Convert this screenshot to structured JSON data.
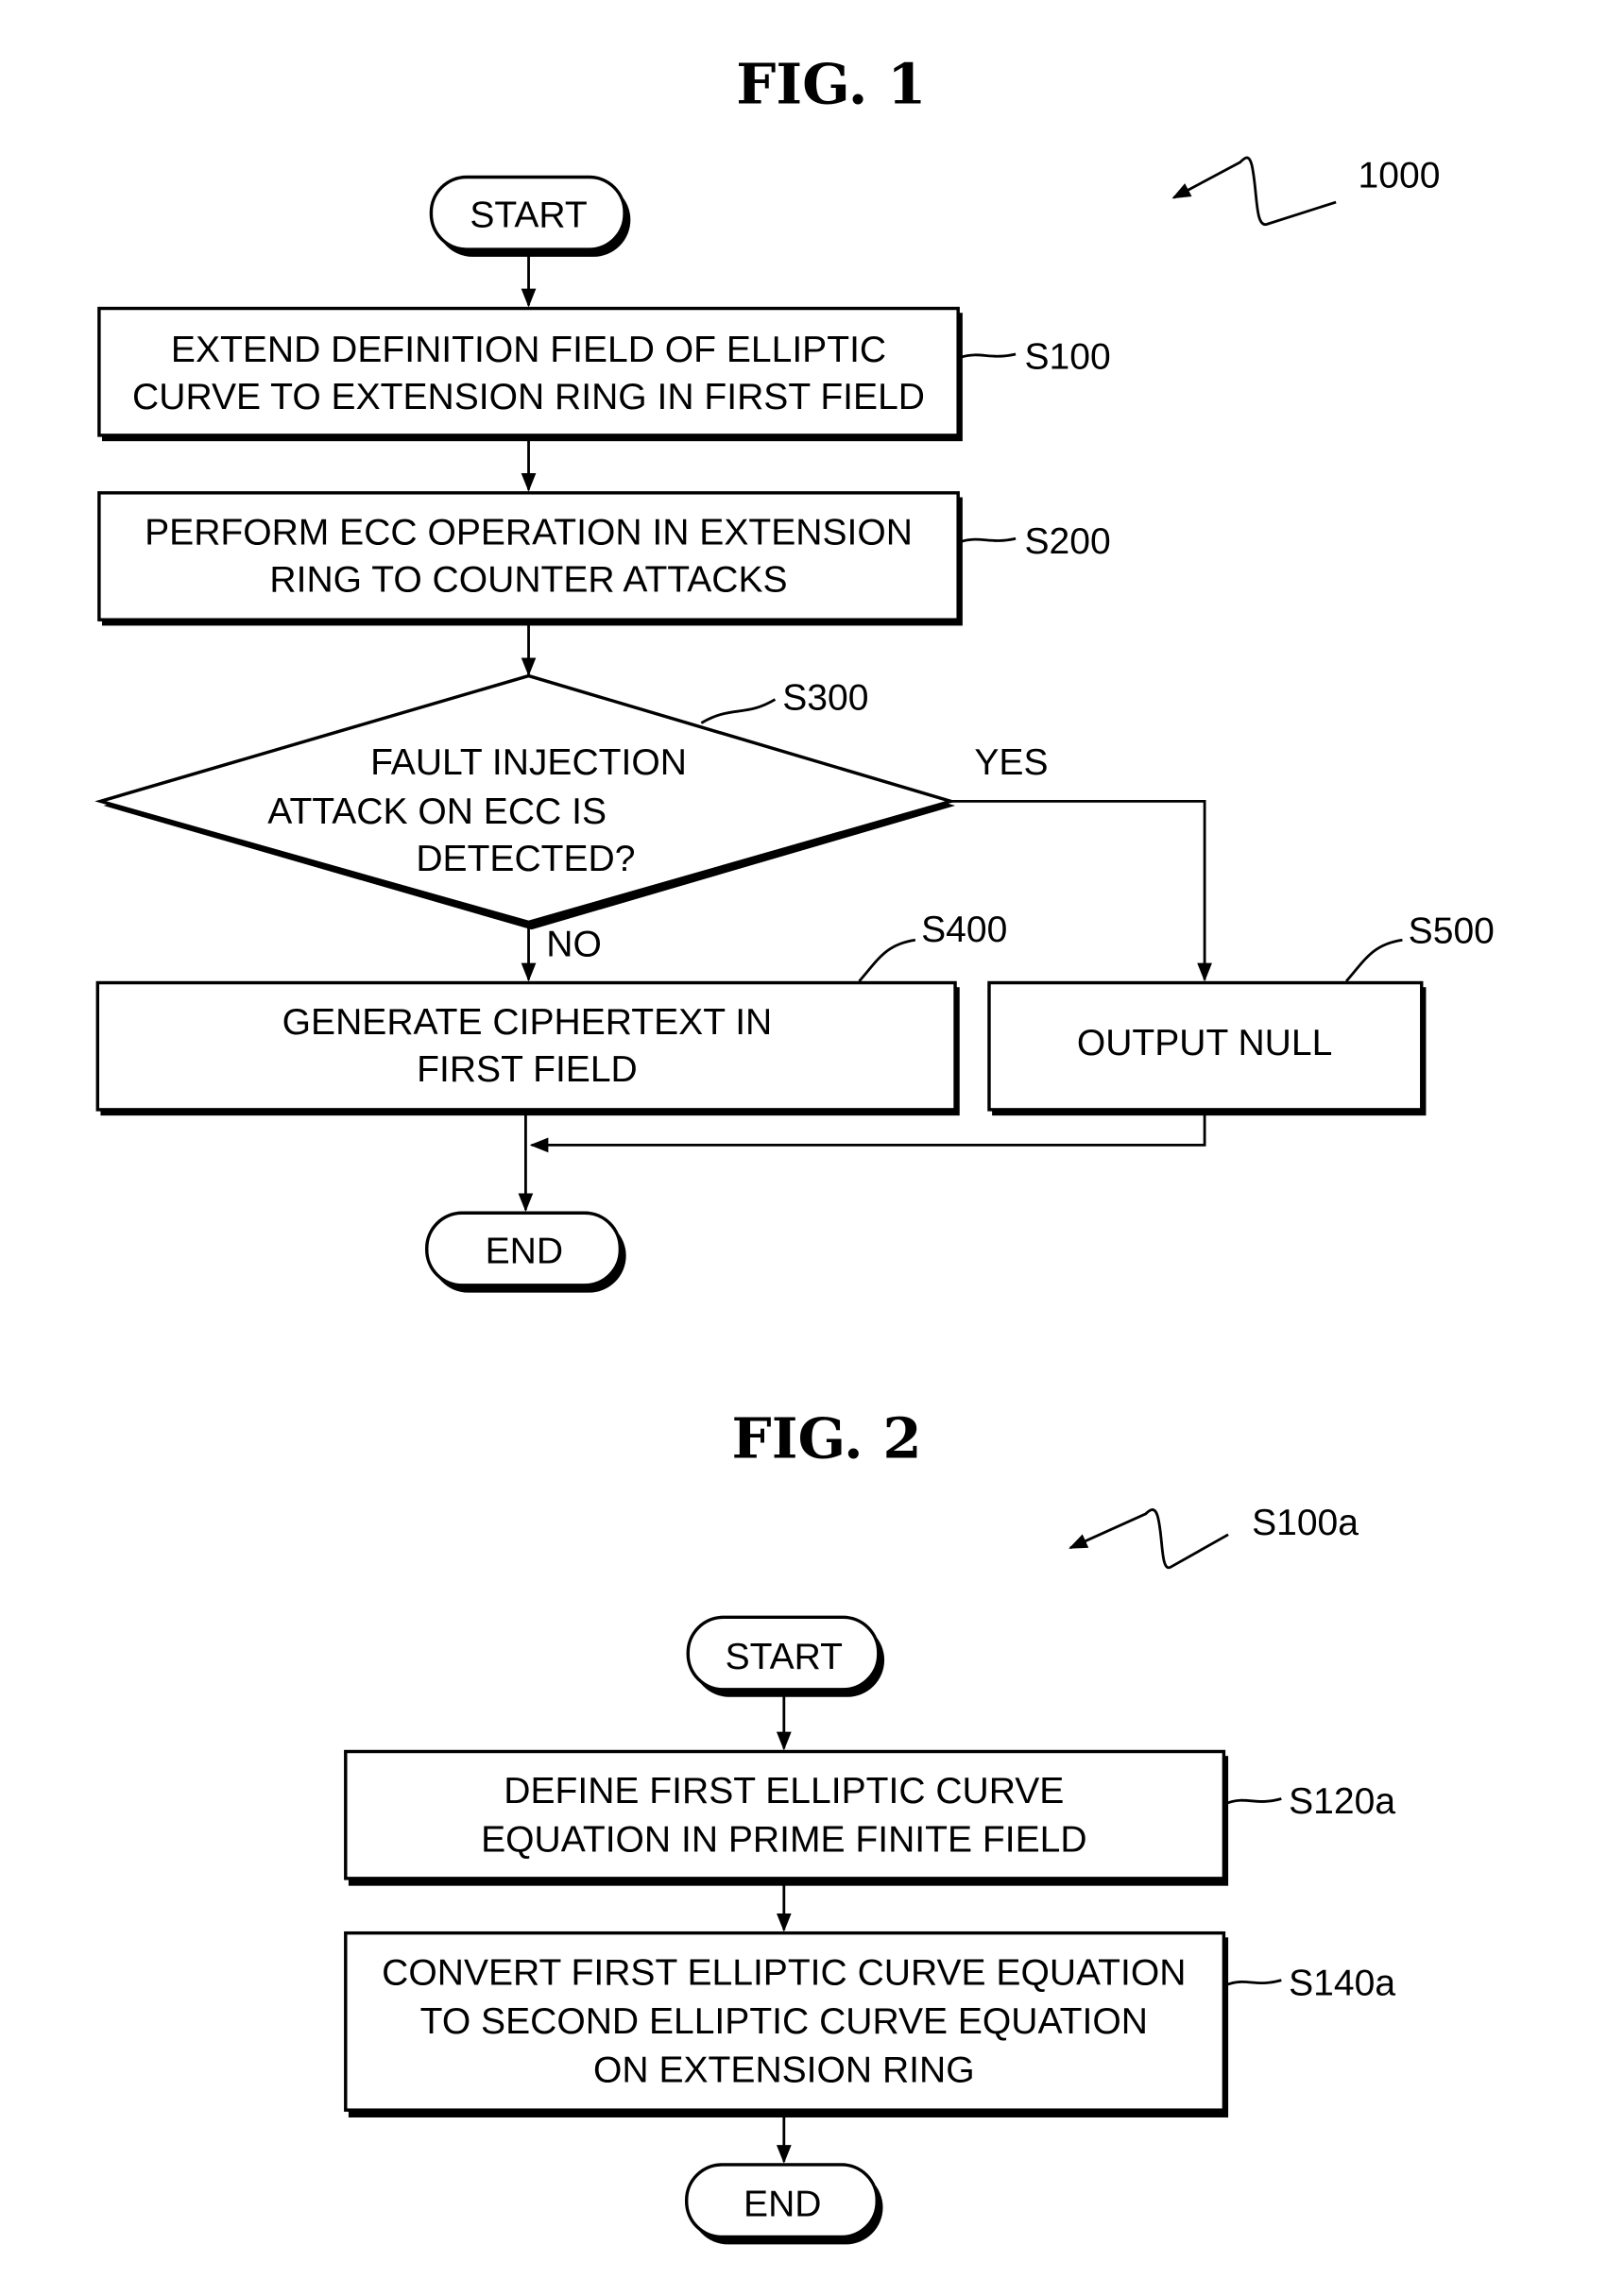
{
  "figures": [
    {
      "title": "FIG.  1",
      "reference": "1000",
      "start_label": "START",
      "end_label": "END",
      "steps": [
        {
          "id": "S100",
          "lines": [
            "EXTEND DEFINITION FIELD OF ELLIPTIC",
            "CURVE TO EXTENSION RING IN FIRST FIELD"
          ]
        },
        {
          "id": "S200",
          "lines": [
            "PERFORM ECC OPERATION IN EXTENSION",
            "RING TO COUNTER ATTACKS"
          ]
        },
        {
          "id": "S300",
          "type": "decision",
          "lines": [
            "FAULT INJECTION",
            "ATTACK ON ECC IS",
            "DETECTED?"
          ],
          "yes_label": "YES",
          "no_label": "NO"
        },
        {
          "id": "S400",
          "lines": [
            "GENERATE CIPHERTEXT IN",
            "FIRST FIELD"
          ]
        },
        {
          "id": "S500",
          "lines": [
            "OUTPUT NULL"
          ]
        }
      ]
    },
    {
      "title": "FIG.  2",
      "reference": "S100a",
      "start_label": "START",
      "end_label": "END",
      "steps": [
        {
          "id": "S120a",
          "lines": [
            "DEFINE FIRST ELLIPTIC CURVE",
            "EQUATION IN PRIME FINITE FIELD"
          ]
        },
        {
          "id": "S140a",
          "lines": [
            "CONVERT FIRST ELLIPTIC CURVE EQUATION",
            "TO SECOND ELLIPTIC CURVE EQUATION",
            "ON EXTENSION RING"
          ]
        }
      ]
    }
  ]
}
